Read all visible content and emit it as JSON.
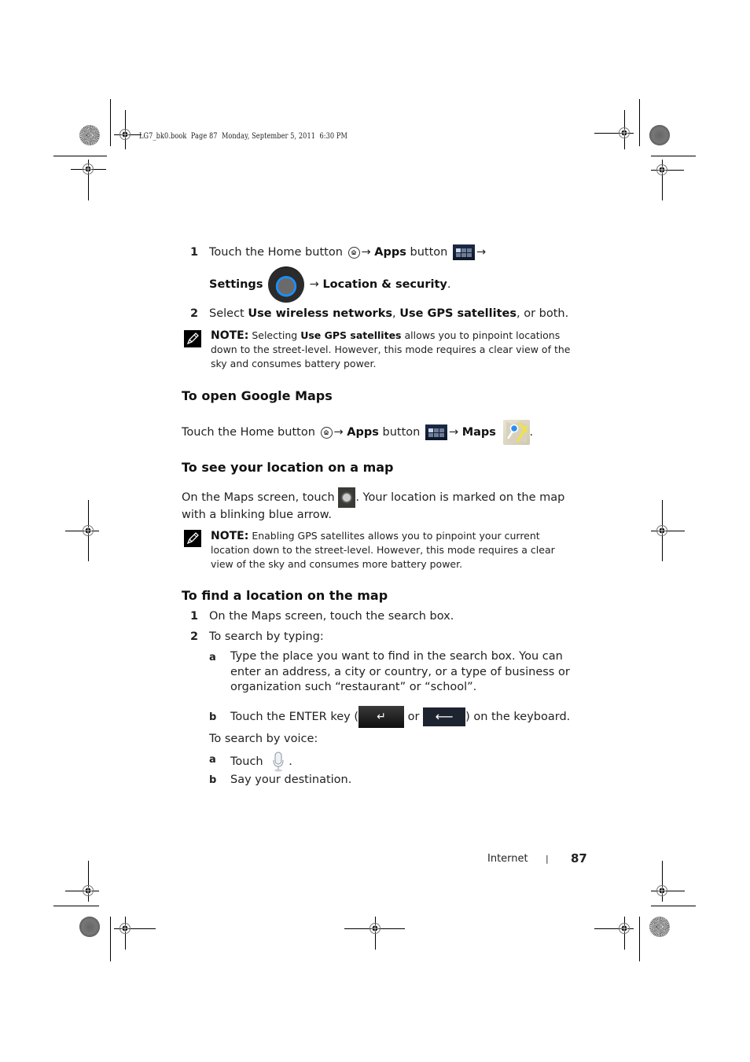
{
  "print_header": "LG7_bk0.book  Page 87  Monday, September 5, 2011  6:30 PM",
  "section1": {
    "steps": [
      {
        "num": "1",
        "parts": {
          "t1": "Touch the Home button",
          "arrow1": "→",
          "apps": "Apps",
          "t2": "button",
          "arrow2": "→",
          "settings": "Settings",
          "arrow3": "→",
          "location": "Location & security",
          "end": "."
        },
        "icons": [
          "home-icon",
          "apps-icon",
          "settings-icon"
        ]
      },
      {
        "num": "2",
        "parts": {
          "t1": "Select",
          "opt1": "Use wireless networks",
          "comma": ",",
          "opt2": "Use GPS satellites",
          "t2": ", or both."
        }
      }
    ],
    "note": {
      "label": "NOTE:",
      "t1": "Selecting",
      "bold": "Use GPS satellites",
      "t2": "allows you to pinpoint locations",
      "line2": "down to the street-level. However, this mode requires a clear view of the",
      "line3": "sky and consumes battery power."
    }
  },
  "section2": {
    "heading": "To open Google Maps",
    "parts": {
      "t1": "Touch the Home button",
      "arrow1": "→",
      "apps": "Apps",
      "t2": "button",
      "arrow2": "→",
      "maps": "Maps",
      "end": "."
    },
    "icons": [
      "home-icon",
      "apps-icon",
      "maps-icon"
    ]
  },
  "section3": {
    "heading": "To see your location on a map",
    "line1a": "On the Maps screen, touch",
    "line1b": ". Your location is marked on the map",
    "line2": "with a blinking blue arrow.",
    "icon": "my-location-icon",
    "note": {
      "label": "NOTE:",
      "line1": "Enabling GPS satellites allows you to pinpoint your current",
      "line2": "location down to the street-level. However, this mode requires a clear",
      "line3": "view of the sky and consumes more battery power."
    }
  },
  "section4": {
    "heading": "To find a location on the map",
    "steps": [
      {
        "num": "1",
        "text": "On the Maps screen, touch the search box."
      },
      {
        "num": "2",
        "text": "To search by typing:"
      }
    ],
    "typing_substeps": [
      {
        "letter": "a",
        "lines": [
          "Type the place you want to find in the search box. You can",
          "enter an address, a city or country, or a type of business or",
          "organization such “restaurant” or “school”."
        ]
      },
      {
        "letter": "b",
        "t1": "Touch the ENTER key (",
        "or": "or",
        "t2": ") on the keyboard.",
        "key1_glyph": "↵",
        "key2_glyph": "⟵"
      }
    ],
    "voice_intro": "To search by voice:",
    "voice_substeps": [
      {
        "letter": "a",
        "t1": "Touch",
        "end": ".",
        "icon": "microphone-icon"
      },
      {
        "letter": "b",
        "text": "Say your destination."
      }
    ]
  },
  "footer": {
    "section": "Internet",
    "separator": "|",
    "page": "87"
  }
}
